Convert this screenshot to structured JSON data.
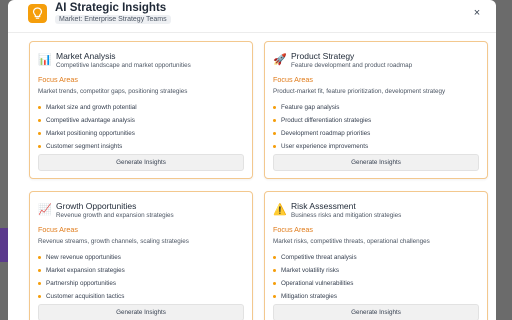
{
  "header": {
    "title": "AI Strategic Insights",
    "context_badge": "Market: Enterprise Strategy Teams",
    "app_icon": "lightbulb-icon",
    "close_label": "×"
  },
  "colors": {
    "accent": "#f59e0b",
    "focus_label": "#e07b1a",
    "card_border": "#f3c88e"
  },
  "cards": [
    {
      "icon": "bar-chart-icon",
      "glyph": "📊",
      "title": "Market Analysis",
      "subtitle": "Competitive landscape and market opportunities",
      "focus_label": "Focus Areas",
      "focus_desc": "Market trends, competitor gaps, positioning strategies",
      "bullets": [
        "Market size and growth potential",
        "Competitive advantage analysis",
        "Market positioning opportunities",
        "Customer segment insights"
      ],
      "button_label": "Generate Insights"
    },
    {
      "icon": "rocket-icon",
      "glyph": "🚀",
      "title": "Product Strategy",
      "subtitle": "Feature development and product roadmap",
      "focus_label": "Focus Areas",
      "focus_desc": "Product-market fit, feature prioritization, development strategy",
      "bullets": [
        "Feature gap analysis",
        "Product differentiation strategies",
        "Development roadmap priorities",
        "User experience improvements"
      ],
      "button_label": "Generate Insights"
    },
    {
      "icon": "trend-chart-icon",
      "glyph": "📈",
      "title": "Growth Opportunities",
      "subtitle": "Revenue growth and expansion strategies",
      "focus_label": "Focus Areas",
      "focus_desc": "Revenue streams, growth channels, scaling strategies",
      "bullets": [
        "New revenue opportunities",
        "Market expansion strategies",
        "Partnership opportunities",
        "Customer acquisition tactics"
      ],
      "button_label": "Generate Insights"
    },
    {
      "icon": "warning-icon",
      "glyph": "⚠️",
      "title": "Risk Assessment",
      "subtitle": "Business risks and mitigation strategies",
      "focus_label": "Focus Areas",
      "focus_desc": "Market risks, competitive threats, operational challenges",
      "bullets": [
        "Competitive threat analysis",
        "Market volatility risks",
        "Operational vulnerabilities",
        "Mitigation strategies"
      ],
      "button_label": "Generate Insights"
    }
  ]
}
